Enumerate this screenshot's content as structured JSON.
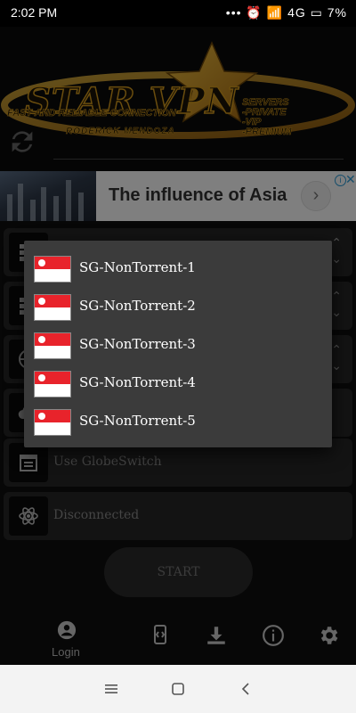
{
  "status_bar": {
    "time": "2:02 PM",
    "icons": "••• ⏰ 4G 4G 7%",
    "battery": "7%"
  },
  "logo": {
    "title": "STAR VPN",
    "tagline": "FAST AND RELIABLE CONNECTION",
    "author": "RODERICK MENDOZA",
    "features": [
      "SERVERS",
      "-PRIVATE",
      "-VIP",
      "-PREMIUM"
    ]
  },
  "ad": {
    "title": "The influence of Asia"
  },
  "cards": {
    "globeswitch": "Use GlobeSwitch",
    "status": "Disconnected"
  },
  "start_label": "START",
  "nav": {
    "login_label": "Login"
  },
  "dialog": {
    "servers": [
      {
        "label": "SG-NonTorrent-1"
      },
      {
        "label": "SG-NonTorrent-2"
      },
      {
        "label": "SG-NonTorrent-3"
      },
      {
        "label": "SG-NonTorrent-4"
      },
      {
        "label": "SG-NonTorrent-5"
      }
    ]
  },
  "colors": {
    "accent_gold": "#d49a1d",
    "flag_red": "#e8232b",
    "dialog_bg": "#3b3b3b"
  }
}
